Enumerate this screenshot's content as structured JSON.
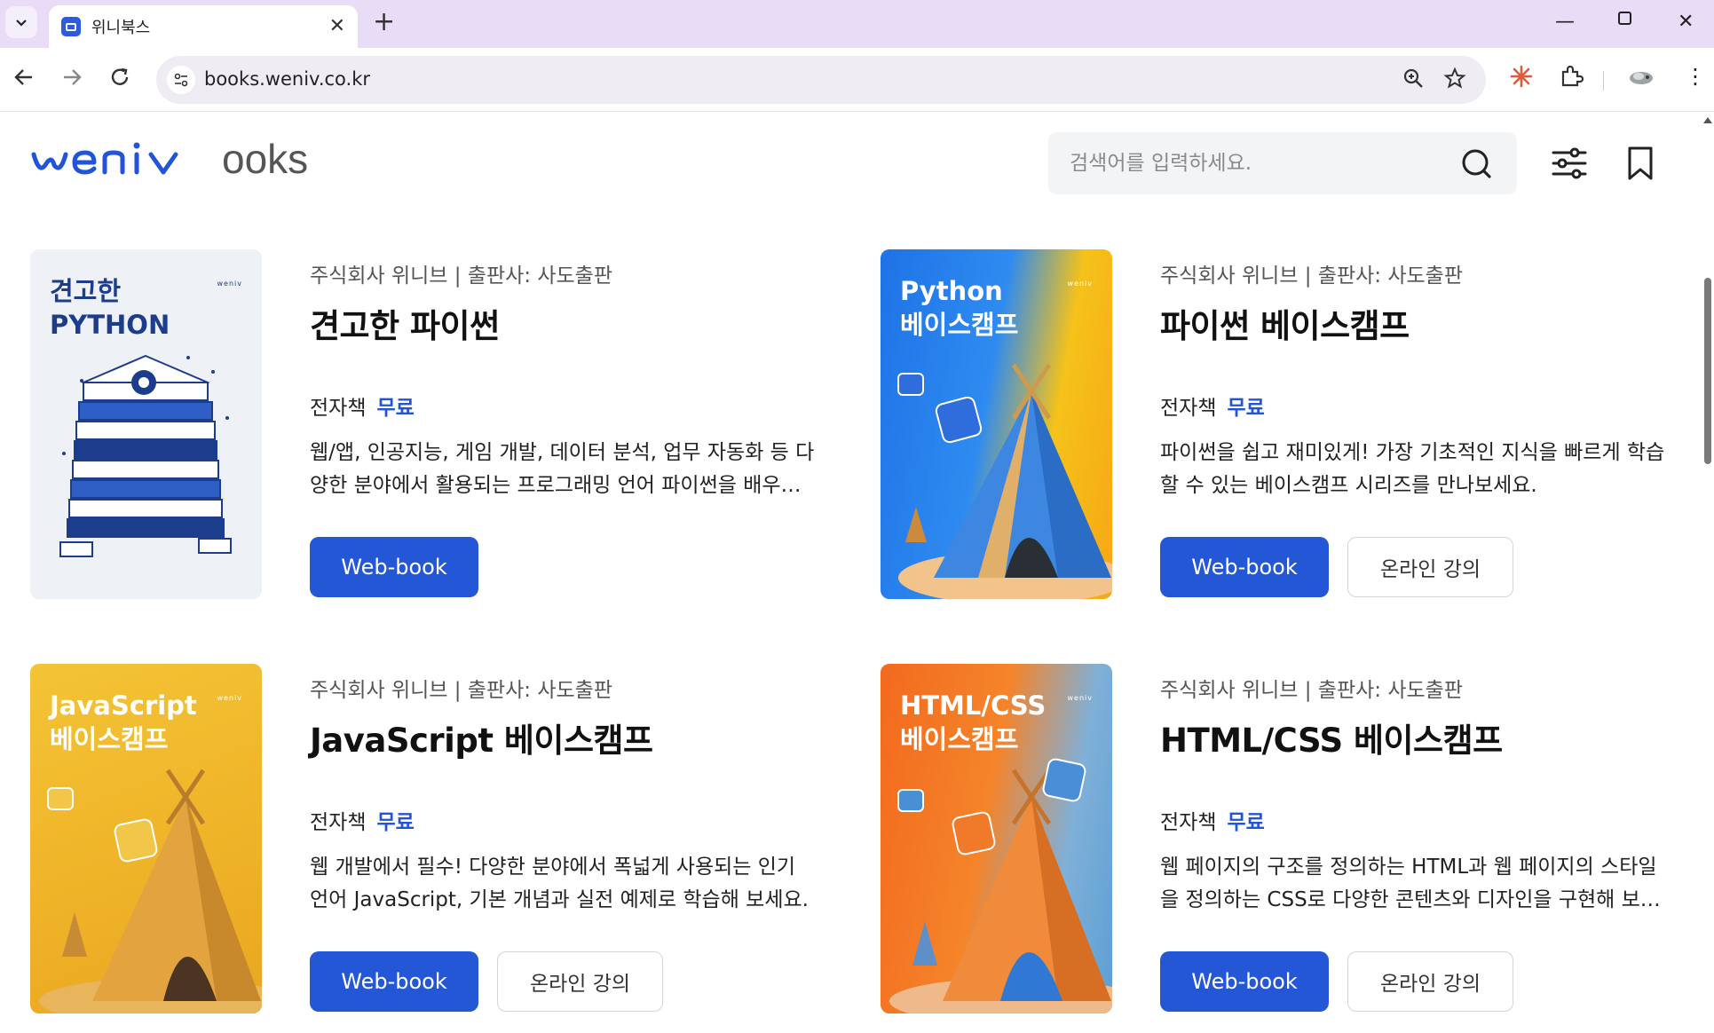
{
  "browser": {
    "tab_title": "위니북스",
    "url": "books.weniv.co.kr"
  },
  "header": {
    "logo_primary": "weniv",
    "logo_secondary": "ooks",
    "search_placeholder": "검색어를 입력하세요."
  },
  "colors": {
    "accent": "#2457d6",
    "price": "#2154d8",
    "tab_bar": "#e8dcf6"
  },
  "books": [
    {
      "cover_title": "견고한\nPYTHON",
      "publisher": "주식회사 위니브 | 출판사: 사도출판",
      "title": "견고한 파이썬",
      "type": "전자책",
      "price": "무료",
      "description": "웹/앱, 인공지능, 게임 개발, 데이터 분석, 업무 자동화 등 다양한 분야에서 활용되는 프로그래밍 언어 파이썬을 배우는 책",
      "webbook_label": "Web-book",
      "lecture_label": ""
    },
    {
      "cover_title": "Python\n베이스캠프",
      "publisher": "주식회사 위니브 | 출판사: 사도출판",
      "title": "파이썬 베이스캠프",
      "type": "전자책",
      "price": "무료",
      "description": "파이썬을 쉽고 재미있게! 가장 기초적인 지식을 빠르게 학습할 수 있는 베이스캠프 시리즈를 만나보세요.",
      "webbook_label": "Web-book",
      "lecture_label": "온라인 강의"
    },
    {
      "cover_title": "JavaScript\n베이스캠프",
      "publisher": "주식회사 위니브 | 출판사: 사도출판",
      "title": "JavaScript 베이스캠프",
      "type": "전자책",
      "price": "무료",
      "description": "웹 개발에서 필수! 다양한 분야에서 폭넓게 사용되는 인기 언어 JavaScript, 기본 개념과 실전 예제로 학습해 보세요.",
      "webbook_label": "Web-book",
      "lecture_label": "온라인 강의"
    },
    {
      "cover_title": "HTML/CSS\n베이스캠프",
      "publisher": "주식회사 위니브 | 출판사: 사도출판",
      "title": "HTML/CSS 베이스캠프",
      "type": "전자책",
      "price": "무료",
      "description": "웹 페이지의 구조를 정의하는 HTML과 웹 페이지의 스타일을 정의하는 CSS로 다양한 콘텐츠와 디자인을 구현해 보세요.",
      "webbook_label": "Web-book",
      "lecture_label": "온라인 강의"
    }
  ]
}
